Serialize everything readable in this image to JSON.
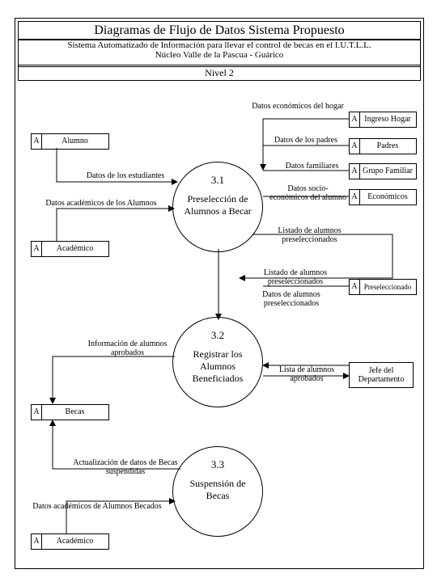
{
  "header": {
    "title": "Diagramas de Flujo de Datos Sistema Propuesto",
    "subtitle1": "Sistema Automatizado de Información para llevar el control de becas en el I.U.T.L.L.",
    "subtitle2": "Núcleo Valle de la Pascua - Guárico",
    "level": "Nivel 2"
  },
  "processes": {
    "p31": {
      "num": "3.1",
      "name": "Preselección de Alumnos a Becar"
    },
    "p32": {
      "num": "3.2",
      "name": "Registrar los Alumnos Beneficiados"
    },
    "p33": {
      "num": "3.3",
      "name": "Suspensión de Becas"
    }
  },
  "stores": {
    "a_label": "A",
    "alumno": "Alumno",
    "academico": "Académico",
    "becas": "Becas",
    "academico2": "Académico",
    "ingreso_hogar": "Ingreso Hogar",
    "padres": "Padres",
    "grupo_familiar": "Grupo Familiar",
    "economicos": "Económicos",
    "preseleccionado": "Preseleccionado"
  },
  "external": {
    "jefe": "Jefe del Departamento"
  },
  "flows": {
    "datos_estudiantes": "Datos de los estudiantes",
    "datos_academicos_alumnos": "Datos académicos de los Alumnos",
    "datos_econ_hogar": "Datos económicos del hogar",
    "datos_padres": "Datos de los padres",
    "datos_familiares": "Datos familiares",
    "datos_socio_econ": "Datos socio-económicos del alumno",
    "listado_presel1": "Listado de alumnos preseleccionados",
    "listado_presel2": "Listado de alumnos preseleccionados",
    "datos_presel": "Datos de alumnos preseleccionados",
    "info_aprobados": "Información de alumnos aprobados",
    "lista_aprobados": "Lista de alumnos aprobados",
    "actualizacion_becas": "Actualización de datos de Becas suspendidas",
    "datos_acad_becados": "Datos académicos de Alumnos Becados"
  }
}
